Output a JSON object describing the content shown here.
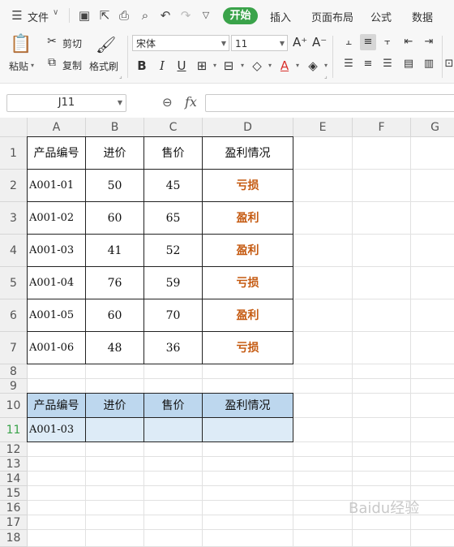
{
  "menubar": {
    "file_label": "文件",
    "tabs": [
      "开始",
      "插入",
      "页面布局",
      "公式",
      "数据"
    ]
  },
  "ribbon": {
    "paste_label": "粘贴",
    "cut_label": "剪切",
    "copy_label": "复制",
    "format_painter_label": "格式刷",
    "font_name": "宋体",
    "font_size": "11",
    "bold": "B",
    "italic": "I",
    "underline": "U"
  },
  "formula_bar": {
    "cell_ref": "J11",
    "fx_label": "fx",
    "formula": ""
  },
  "sheet": {
    "columns": [
      "A",
      "B",
      "C",
      "D",
      "E",
      "F",
      "G"
    ],
    "row_numbers": [
      "1",
      "2",
      "3",
      "4",
      "5",
      "6",
      "7",
      "8",
      "9",
      "10",
      "11",
      "12",
      "13",
      "14",
      "15",
      "16",
      "17",
      "18"
    ],
    "headers": [
      "产品编号",
      "进价",
      "售价",
      "盈利情况"
    ],
    "rows": [
      [
        "A001-01",
        "50",
        "45",
        "亏损"
      ],
      [
        "A001-02",
        "60",
        "65",
        "盈利"
      ],
      [
        "A001-03",
        "41",
        "52",
        "盈利"
      ],
      [
        "A001-04",
        "76",
        "59",
        "亏损"
      ],
      [
        "A001-05",
        "60",
        "70",
        "盈利"
      ],
      [
        "A001-06",
        "48",
        "36",
        "亏损"
      ]
    ],
    "lookup_headers": [
      "产品编号",
      "进价",
      "售价",
      "盈利情况"
    ],
    "lookup_row": [
      "A001-03",
      "",
      "",
      ""
    ]
  },
  "colors": {
    "accent_green": "#3aa34a",
    "result_text": "#c55a11",
    "lookup_header_bg": "#bdd7ee",
    "lookup_row_bg": "#ddebf7"
  },
  "watermark": "Baidu经验"
}
